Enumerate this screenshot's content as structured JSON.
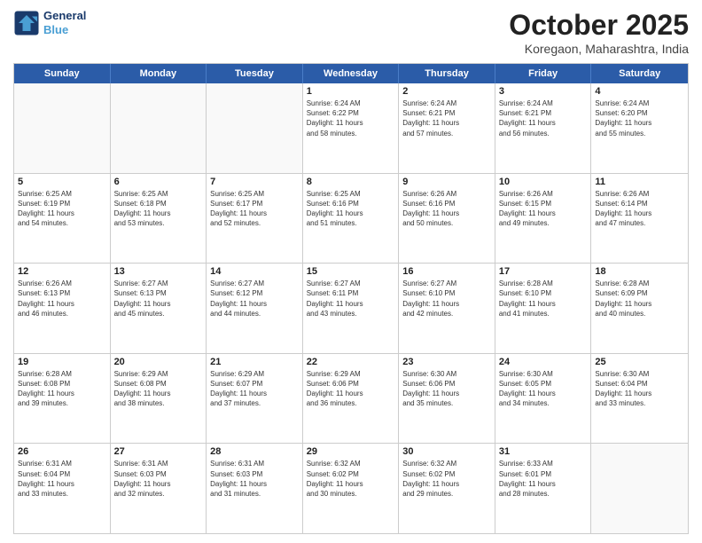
{
  "header": {
    "logo_line1": "General",
    "logo_line2": "Blue",
    "month": "October 2025",
    "location": "Koregaon, Maharashtra, India"
  },
  "days_of_week": [
    "Sunday",
    "Monday",
    "Tuesday",
    "Wednesday",
    "Thursday",
    "Friday",
    "Saturday"
  ],
  "rows": [
    [
      {
        "day": "",
        "lines": []
      },
      {
        "day": "",
        "lines": []
      },
      {
        "day": "",
        "lines": []
      },
      {
        "day": "1",
        "lines": [
          "Sunrise: 6:24 AM",
          "Sunset: 6:22 PM",
          "Daylight: 11 hours",
          "and 58 minutes."
        ]
      },
      {
        "day": "2",
        "lines": [
          "Sunrise: 6:24 AM",
          "Sunset: 6:21 PM",
          "Daylight: 11 hours",
          "and 57 minutes."
        ]
      },
      {
        "day": "3",
        "lines": [
          "Sunrise: 6:24 AM",
          "Sunset: 6:21 PM",
          "Daylight: 11 hours",
          "and 56 minutes."
        ]
      },
      {
        "day": "4",
        "lines": [
          "Sunrise: 6:24 AM",
          "Sunset: 6:20 PM",
          "Daylight: 11 hours",
          "and 55 minutes."
        ]
      }
    ],
    [
      {
        "day": "5",
        "lines": [
          "Sunrise: 6:25 AM",
          "Sunset: 6:19 PM",
          "Daylight: 11 hours",
          "and 54 minutes."
        ]
      },
      {
        "day": "6",
        "lines": [
          "Sunrise: 6:25 AM",
          "Sunset: 6:18 PM",
          "Daylight: 11 hours",
          "and 53 minutes."
        ]
      },
      {
        "day": "7",
        "lines": [
          "Sunrise: 6:25 AM",
          "Sunset: 6:17 PM",
          "Daylight: 11 hours",
          "and 52 minutes."
        ]
      },
      {
        "day": "8",
        "lines": [
          "Sunrise: 6:25 AM",
          "Sunset: 6:16 PM",
          "Daylight: 11 hours",
          "and 51 minutes."
        ]
      },
      {
        "day": "9",
        "lines": [
          "Sunrise: 6:26 AM",
          "Sunset: 6:16 PM",
          "Daylight: 11 hours",
          "and 50 minutes."
        ]
      },
      {
        "day": "10",
        "lines": [
          "Sunrise: 6:26 AM",
          "Sunset: 6:15 PM",
          "Daylight: 11 hours",
          "and 49 minutes."
        ]
      },
      {
        "day": "11",
        "lines": [
          "Sunrise: 6:26 AM",
          "Sunset: 6:14 PM",
          "Daylight: 11 hours",
          "and 47 minutes."
        ]
      }
    ],
    [
      {
        "day": "12",
        "lines": [
          "Sunrise: 6:26 AM",
          "Sunset: 6:13 PM",
          "Daylight: 11 hours",
          "and 46 minutes."
        ]
      },
      {
        "day": "13",
        "lines": [
          "Sunrise: 6:27 AM",
          "Sunset: 6:13 PM",
          "Daylight: 11 hours",
          "and 45 minutes."
        ]
      },
      {
        "day": "14",
        "lines": [
          "Sunrise: 6:27 AM",
          "Sunset: 6:12 PM",
          "Daylight: 11 hours",
          "and 44 minutes."
        ]
      },
      {
        "day": "15",
        "lines": [
          "Sunrise: 6:27 AM",
          "Sunset: 6:11 PM",
          "Daylight: 11 hours",
          "and 43 minutes."
        ]
      },
      {
        "day": "16",
        "lines": [
          "Sunrise: 6:27 AM",
          "Sunset: 6:10 PM",
          "Daylight: 11 hours",
          "and 42 minutes."
        ]
      },
      {
        "day": "17",
        "lines": [
          "Sunrise: 6:28 AM",
          "Sunset: 6:10 PM",
          "Daylight: 11 hours",
          "and 41 minutes."
        ]
      },
      {
        "day": "18",
        "lines": [
          "Sunrise: 6:28 AM",
          "Sunset: 6:09 PM",
          "Daylight: 11 hours",
          "and 40 minutes."
        ]
      }
    ],
    [
      {
        "day": "19",
        "lines": [
          "Sunrise: 6:28 AM",
          "Sunset: 6:08 PM",
          "Daylight: 11 hours",
          "and 39 minutes."
        ]
      },
      {
        "day": "20",
        "lines": [
          "Sunrise: 6:29 AM",
          "Sunset: 6:08 PM",
          "Daylight: 11 hours",
          "and 38 minutes."
        ]
      },
      {
        "day": "21",
        "lines": [
          "Sunrise: 6:29 AM",
          "Sunset: 6:07 PM",
          "Daylight: 11 hours",
          "and 37 minutes."
        ]
      },
      {
        "day": "22",
        "lines": [
          "Sunrise: 6:29 AM",
          "Sunset: 6:06 PM",
          "Daylight: 11 hours",
          "and 36 minutes."
        ]
      },
      {
        "day": "23",
        "lines": [
          "Sunrise: 6:30 AM",
          "Sunset: 6:06 PM",
          "Daylight: 11 hours",
          "and 35 minutes."
        ]
      },
      {
        "day": "24",
        "lines": [
          "Sunrise: 6:30 AM",
          "Sunset: 6:05 PM",
          "Daylight: 11 hours",
          "and 34 minutes."
        ]
      },
      {
        "day": "25",
        "lines": [
          "Sunrise: 6:30 AM",
          "Sunset: 6:04 PM",
          "Daylight: 11 hours",
          "and 33 minutes."
        ]
      }
    ],
    [
      {
        "day": "26",
        "lines": [
          "Sunrise: 6:31 AM",
          "Sunset: 6:04 PM",
          "Daylight: 11 hours",
          "and 33 minutes."
        ]
      },
      {
        "day": "27",
        "lines": [
          "Sunrise: 6:31 AM",
          "Sunset: 6:03 PM",
          "Daylight: 11 hours",
          "and 32 minutes."
        ]
      },
      {
        "day": "28",
        "lines": [
          "Sunrise: 6:31 AM",
          "Sunset: 6:03 PM",
          "Daylight: 11 hours",
          "and 31 minutes."
        ]
      },
      {
        "day": "29",
        "lines": [
          "Sunrise: 6:32 AM",
          "Sunset: 6:02 PM",
          "Daylight: 11 hours",
          "and 30 minutes."
        ]
      },
      {
        "day": "30",
        "lines": [
          "Sunrise: 6:32 AM",
          "Sunset: 6:02 PM",
          "Daylight: 11 hours",
          "and 29 minutes."
        ]
      },
      {
        "day": "31",
        "lines": [
          "Sunrise: 6:33 AM",
          "Sunset: 6:01 PM",
          "Daylight: 11 hours",
          "and 28 minutes."
        ]
      },
      {
        "day": "",
        "lines": []
      }
    ]
  ]
}
